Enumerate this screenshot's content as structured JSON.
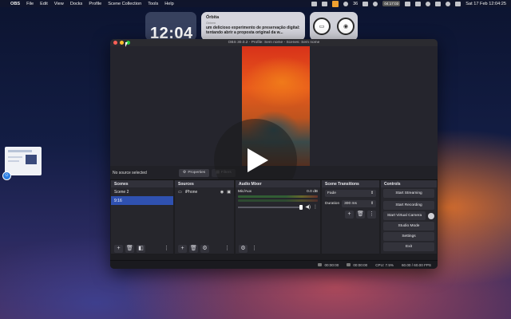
{
  "menubar": {
    "apple": "",
    "items": [
      "OBS",
      "File",
      "Edit",
      "View",
      "Docks",
      "Profile",
      "Scene Collection",
      "Tools",
      "Help"
    ],
    "screen_record_time": "04:17:03",
    "wifi_value": "36",
    "datetime": "Sat 17 Feb  12:04:25"
  },
  "widgets": {
    "clock_time": "12:04",
    "news_source": "Órbita",
    "news_subtitle": "Ontem",
    "news_headline": "um delicioso experimento de preservação digital: tentando abrir a proposta original da w..."
  },
  "obs": {
    "title": "OBS 30.0.2 - Profile: Sem nome - Scenes: Sem nome",
    "no_source": "No source selected",
    "properties_label": "Properties",
    "filters_label": "Filters",
    "scenes": {
      "header": "Scenes",
      "items": [
        "Scene 2",
        "9:16"
      ],
      "active_index": 1
    },
    "sources": {
      "header": "Sources",
      "items": [
        "iPhone"
      ]
    },
    "mixer": {
      "header": "Audio Mixer",
      "channel": "Mic/Aux",
      "db": "0.0 dB"
    },
    "transitions": {
      "header": "Scene Transitions",
      "type": "Fade",
      "duration_label": "Duration",
      "duration_value": "300 ms"
    },
    "controls": {
      "header": "Controls",
      "buttons": [
        "Start Streaming",
        "Start Recording",
        "Start Virtual Camera",
        "Studio Mode",
        "Settings",
        "Exit"
      ]
    },
    "status": {
      "stream_time": "00:00:00",
      "record_time": "00:00:00",
      "cpu": "CPU: 7.5%",
      "fps": "60.00 / 60.00 FPS"
    }
  },
  "icons": {
    "play": "play-icon",
    "gear": "gear-icon",
    "eye": "eye-icon",
    "lock": "lock-icon"
  }
}
